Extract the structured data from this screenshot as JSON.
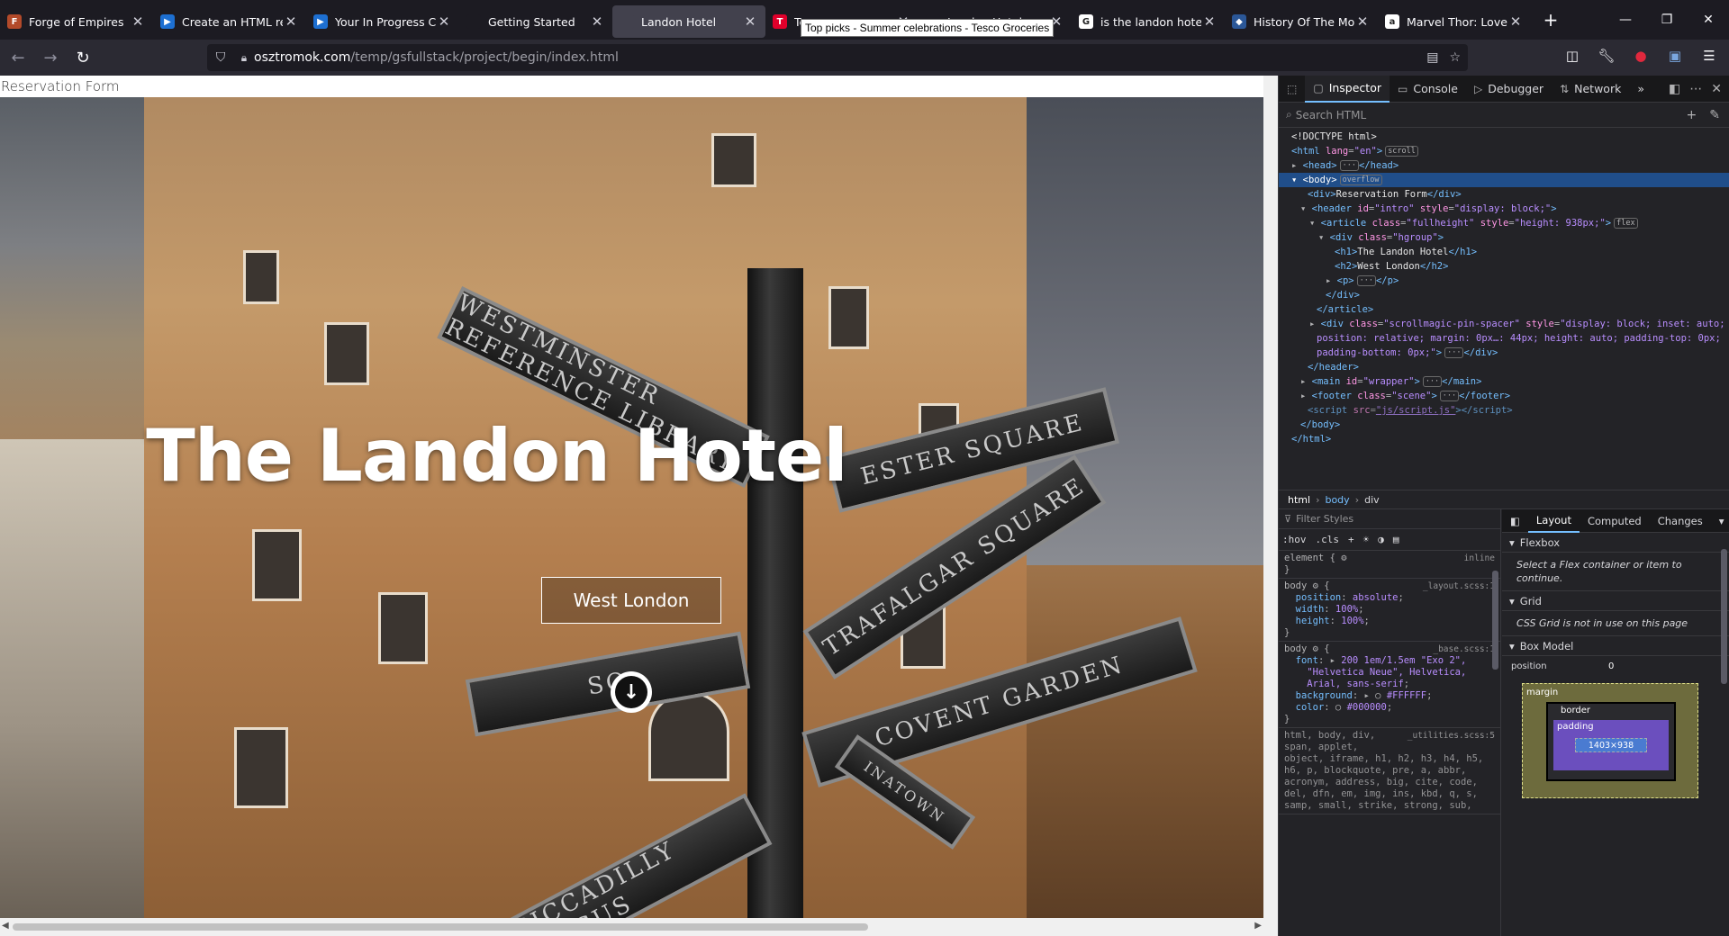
{
  "tabs": [
    {
      "title": "Forge of Empires",
      "fav": "F",
      "favcolor": "#b34a2a"
    },
    {
      "title": "Create an HTML rese",
      "fav": "▶",
      "favcolor": "#1d6fd1"
    },
    {
      "title": "Your In Progress Cont",
      "fav": "▶",
      "favcolor": "#1d6fd1"
    },
    {
      "title": "Getting Started",
      "fav": "",
      "favcolor": "#1c1b22"
    },
    {
      "title": "Landon Hotel",
      "fav": "",
      "favcolor": "#42414d",
      "active": true
    },
    {
      "title": "Te",
      "fav": "T",
      "favcolor": "#e0002b"
    },
    {
      "title": "Landon Hotel",
      "fav": "",
      "favcolor": "#1c1b22"
    },
    {
      "title": "is the landon hotel a",
      "fav": "G",
      "favcolor": "#ffffff"
    },
    {
      "title": "History Of The Most F",
      "fav": "◆",
      "favcolor": "#2b5797"
    },
    {
      "title": "Marvel Thor: Love an",
      "fav": "a",
      "favcolor": "#ffffff"
    }
  ],
  "tooltip": "Top picks - Summer celebrations - Tesco Groceries",
  "url": {
    "host": "osztromok.com",
    "path": "/temp/gsfullstack/project/begin/index.html"
  },
  "page": {
    "reservation": "Reservation Form",
    "h1": "The Landon Hotel",
    "h2": "West London",
    "arrow": "↓",
    "signs": {
      "westminster": "WESTMINSTER REFERENCE LIBRARY",
      "leicester": "ESTER SQUARE",
      "trafalgar": "TRAFALGAR SQUARE",
      "covent": "COVENT GARDEN",
      "piccadilly": "PICCADILLY CIRCUS",
      "soho": "SO",
      "china": "INATOWN"
    }
  },
  "devtools": {
    "tabs": [
      {
        "label": "Inspector",
        "icon": "inspector-icon",
        "active": true
      },
      {
        "label": "Console",
        "icon": "console-icon"
      },
      {
        "label": "Debugger",
        "icon": "debugger-icon"
      },
      {
        "label": "Network",
        "icon": "network-icon"
      }
    ],
    "search_placeholder": "Search HTML",
    "breadcrumbs": [
      "html",
      "body",
      "div"
    ],
    "filter_placeholder": "Filter Styles",
    "hov": ":hov",
    "cls": ".cls",
    "layout_tabs": [
      "Layout",
      "Computed",
      "Changes"
    ],
    "flexbox_title": "Flexbox",
    "flexbox_msg": "Select a Flex container or item to continue.",
    "grid_title": "Grid",
    "grid_msg": "CSS Grid is not in use on this page",
    "boxmodel_title": "Box Model",
    "bm": {
      "position": "position",
      "margin": "margin",
      "border": "border",
      "padding": "padding",
      "content": "1403×938",
      "zero": "0"
    }
  }
}
